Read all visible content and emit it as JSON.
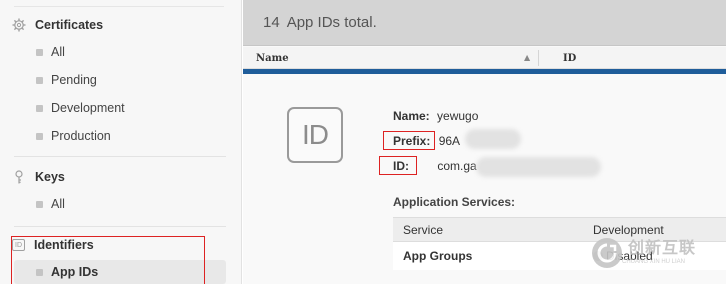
{
  "sidebar": {
    "certificates": {
      "heading": "Certificates",
      "icon": "gear-icon",
      "items": [
        "All",
        "Pending",
        "Development",
        "Production"
      ]
    },
    "keys": {
      "heading": "Keys",
      "icon": "key-icon",
      "items": [
        "All"
      ]
    },
    "identifiers": {
      "heading": "Identifiers",
      "icon_text": "ID",
      "items": [
        "App IDs"
      ],
      "active_item": "App IDs"
    }
  },
  "main": {
    "total_count": "14",
    "total_suffix": "App IDs total.",
    "columns": {
      "name": "Name",
      "id": "ID",
      "sort_indicator": "▲"
    },
    "detail": {
      "badge": "ID",
      "name_label": "Name:",
      "name_value": "yewugo",
      "prefix_label": "Prefix:",
      "prefix_value": "96A",
      "id_label": "ID:",
      "id_value": "com.ga"
    },
    "services": {
      "title": "Application Services:",
      "header_service": "Service",
      "header_development": "Development",
      "rows": [
        {
          "service": "App Groups",
          "development": "Disabled"
        }
      ]
    }
  },
  "watermark": {
    "text": "创新互联",
    "sub": "CHUANG XIN HU LIAN"
  },
  "colors": {
    "accent_bar": "#1f5d9a",
    "annotation_red": "#dd2222"
  }
}
